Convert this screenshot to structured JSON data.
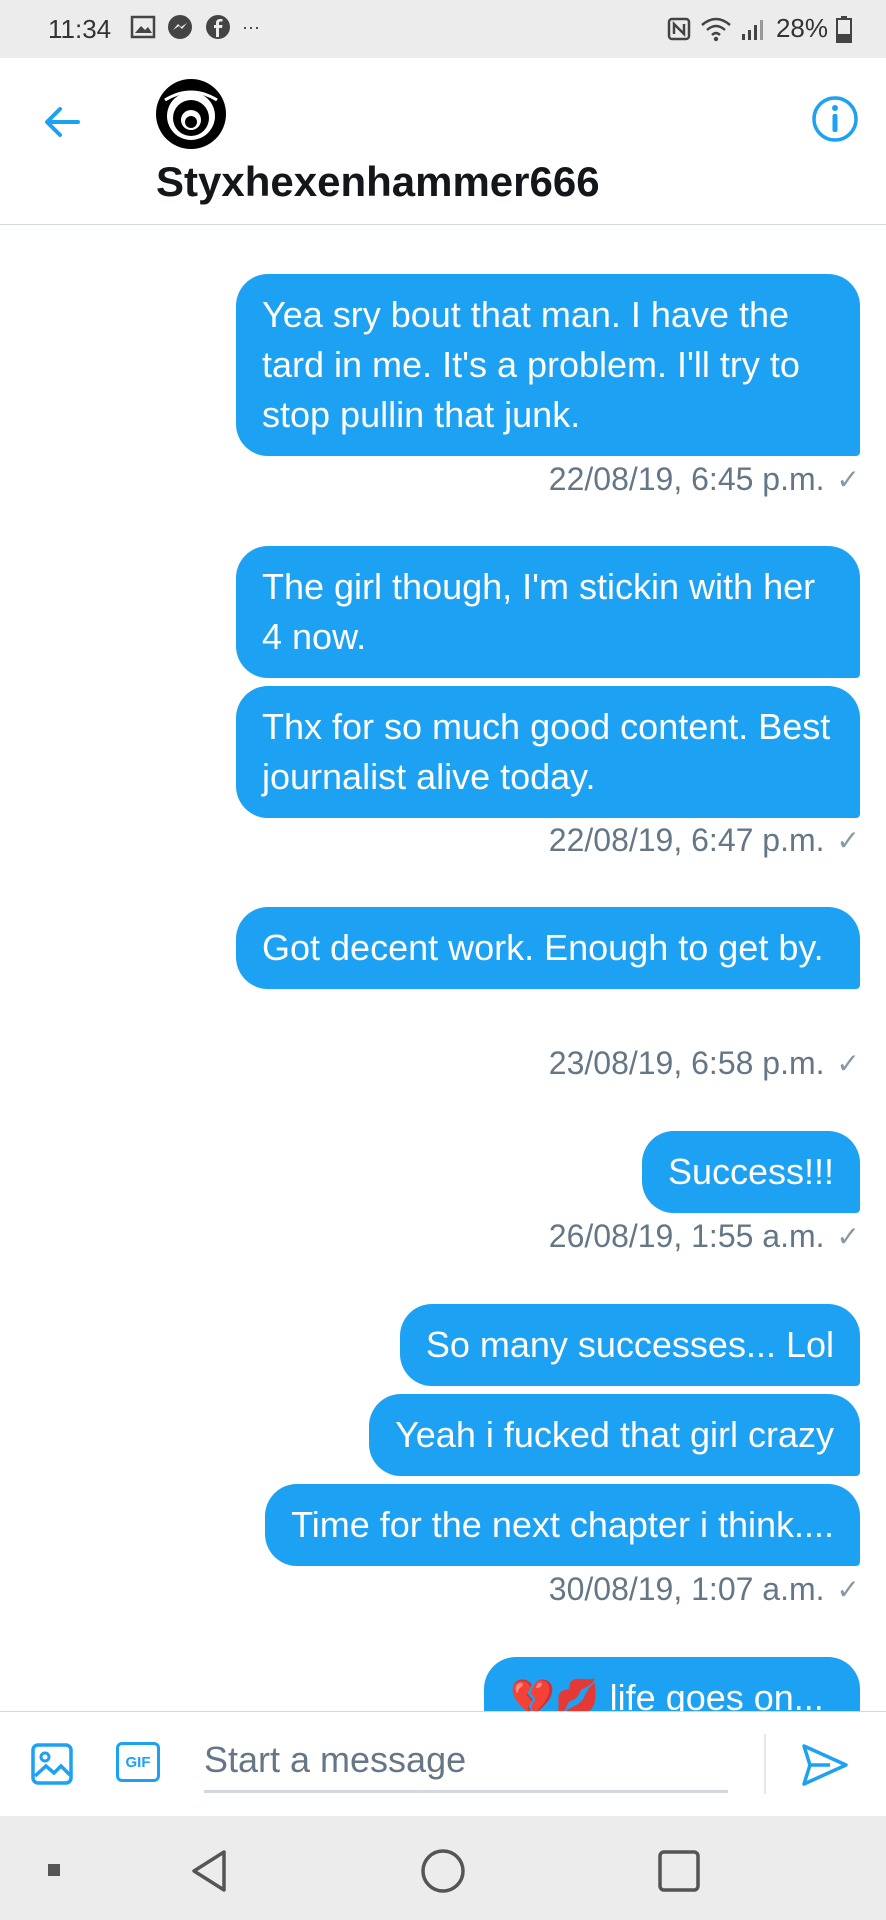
{
  "status_bar": {
    "time": "11:34",
    "more": "···",
    "battery": "28%"
  },
  "header": {
    "contact_name": "Styxhexenhammer666",
    "back_icon": "arrow-left-icon",
    "info_icon": "info-icon"
  },
  "messages": [
    {
      "text": "Yea sry bout that man. I have the tard in me. It's a problem. I'll try to stop pullin that junk."
    },
    {
      "timestamp": "22/08/19, 6:45 p.m."
    },
    {
      "text": "The girl though, I'm stickin with her 4 now."
    },
    {
      "text": "Thx for so much good content. Best journalist alive today."
    },
    {
      "timestamp": "22/08/19, 6:47 p.m."
    },
    {
      "text": "Got decent work. Enough to get by."
    },
    {
      "timestamp": "23/08/19, 6:58 p.m."
    },
    {
      "text": "Success!!!"
    },
    {
      "timestamp": "26/08/19, 1:55 a.m."
    },
    {
      "text": "So many successes... Lol"
    },
    {
      "text": "Yeah i fucked that girl crazy"
    },
    {
      "text": "Time for the next chapter i think...."
    },
    {
      "timestamp": "30/08/19, 1:07 a.m."
    },
    {
      "text": "life goes on..."
    }
  ],
  "composer": {
    "placeholder": "Start a message",
    "gif_label": "GIF"
  },
  "colors": {
    "accent": "#1da1f2",
    "bubble_text": "#ffffff",
    "timestamp": "#657786"
  }
}
